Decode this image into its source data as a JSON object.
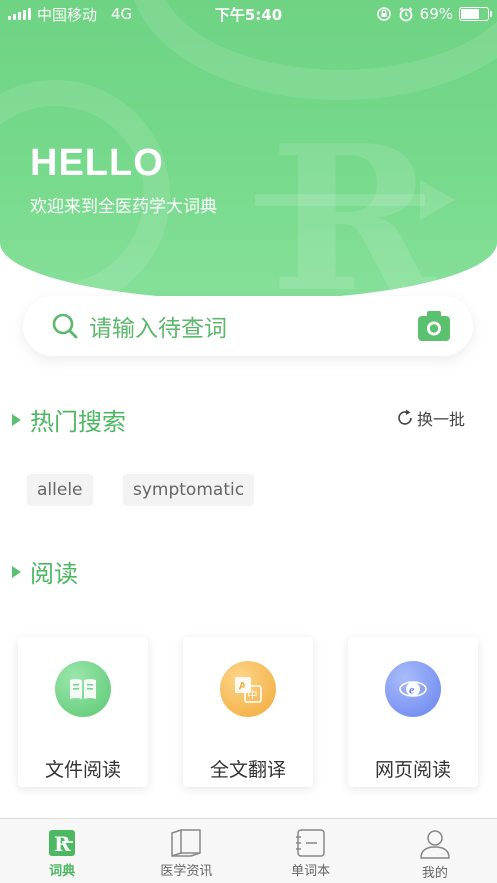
{
  "status_bar": {
    "carrier": "中国移动",
    "network": "4G",
    "time": "下午5:40",
    "battery": "69%",
    "battery_level": 0.69
  },
  "hero": {
    "greeting": "HELLO",
    "subtitle": "欢迎来到全医药学大词典"
  },
  "search": {
    "placeholder": "请输入待查词",
    "search_icon": "search-icon",
    "camera_icon": "camera-icon"
  },
  "hot_search": {
    "title": "热门搜索",
    "refresh_label": "换一批",
    "tags": [
      "allele",
      "symptomatic"
    ]
  },
  "reading": {
    "title": "阅读",
    "cards": [
      {
        "label": "文件阅读",
        "icon": "book-icon",
        "color": "#6dd38a"
      },
      {
        "label": "全文翻译",
        "icon": "translate-icon",
        "color": "#f5b041"
      },
      {
        "label": "网页阅读",
        "icon": "browser-icon",
        "color": "#6d8ff0"
      }
    ]
  },
  "tabbar": {
    "items": [
      {
        "label": "词典",
        "icon": "dictionary-icon",
        "active": true
      },
      {
        "label": "医学资讯",
        "icon": "news-icon",
        "active": false
      },
      {
        "label": "单词本",
        "icon": "wordbook-icon",
        "active": false
      },
      {
        "label": "我的",
        "icon": "profile-icon",
        "active": false
      }
    ]
  },
  "colors": {
    "accent": "#4cb962",
    "hero": "#76d98b"
  }
}
